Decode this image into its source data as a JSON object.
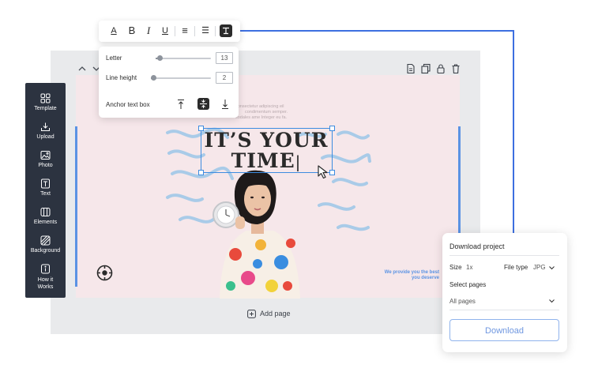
{
  "text_toolbar": {
    "buttons": [
      {
        "name": "font-color",
        "glyph": "A"
      },
      {
        "name": "bold",
        "glyph": "B"
      },
      {
        "name": "italic",
        "glyph": "I"
      },
      {
        "name": "underline",
        "glyph": "U"
      },
      {
        "name": "align",
        "glyph": "≡"
      },
      {
        "name": "list",
        "glyph": "☰"
      }
    ]
  },
  "text_panel": {
    "letter_label": "Letter",
    "letter_value": "13",
    "letter_level": 0.1,
    "line_height_label": "Line height",
    "line_height_value": "2",
    "line_height_level": 0.05,
    "anchor_label": "Anchor text box"
  },
  "sidebar": {
    "items": [
      {
        "label": "Template",
        "icon": "grid-icon"
      },
      {
        "label": "Upload",
        "icon": "upload-icon"
      },
      {
        "label": "Photo",
        "icon": "photo-icon"
      },
      {
        "label": "Text",
        "icon": "text-icon"
      },
      {
        "label": "Elements",
        "icon": "elements-icon"
      },
      {
        "label": "Background",
        "icon": "background-icon"
      },
      {
        "label": "How it",
        "label2": "Works",
        "icon": "info-icon"
      }
    ]
  },
  "canvas": {
    "headline_line1": "IT’S YOUR",
    "headline_line2": "TIME",
    "faint_text_1": "consectetur adipiscing eil",
    "faint_text_2": "condimentum semper.",
    "faint_text_3": "sodales ame Integer eu fa.",
    "blurb_line1": "We provide you the best",
    "blurb_line2": "you deserve",
    "add_page_label": "Add page"
  },
  "download_panel": {
    "title": "Download project",
    "size_label": "Size",
    "size_value": "1x",
    "file_type_label": "File type",
    "file_type_value": "JPG",
    "select_pages_label": "Select pages",
    "pages_value": "All pages",
    "download_button": "Download"
  },
  "colors": {
    "accent_blue": "#3d6fe0",
    "sidebar_bg": "#2c3340",
    "canvas_bg": "#f6e7ea"
  }
}
